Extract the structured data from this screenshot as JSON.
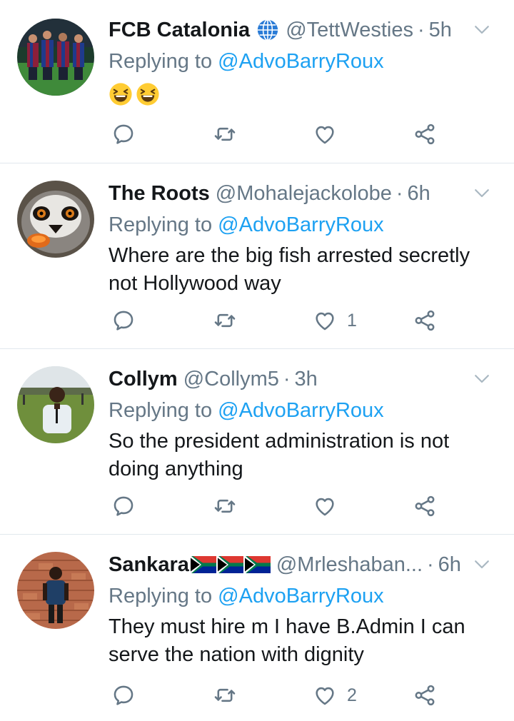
{
  "reply_prefix": "Replying to",
  "tweets": [
    {
      "name": "FCB Catalonia",
      "handle": "@TettWesties",
      "time": "5h",
      "reply_to": "@AdvoBarryRoux",
      "text": "",
      "like_count": ""
    },
    {
      "name": "The Roots",
      "handle": "@Mohalejackolobe",
      "time": "6h",
      "reply_to": "@AdvoBarryRoux",
      "text": "Where are the big fish arrested secretly not Hollywood way",
      "like_count": "1"
    },
    {
      "name": "Collym",
      "handle": "@Collym5",
      "time": "3h",
      "reply_to": "@AdvoBarryRoux",
      "text": "So the president administration is not doing anything",
      "like_count": ""
    },
    {
      "name": "Sankara",
      "handle": "@Mrleshaban...",
      "time": "6h",
      "reply_to": "@AdvoBarryRoux",
      "text": "They must hire m I have B.Admin I can serve the nation with dignity",
      "like_count": "2"
    }
  ],
  "colors": {
    "text": "#14171a",
    "secondary": "#657786",
    "accent": "#1da1f2",
    "divider": "#e1e8ed"
  }
}
